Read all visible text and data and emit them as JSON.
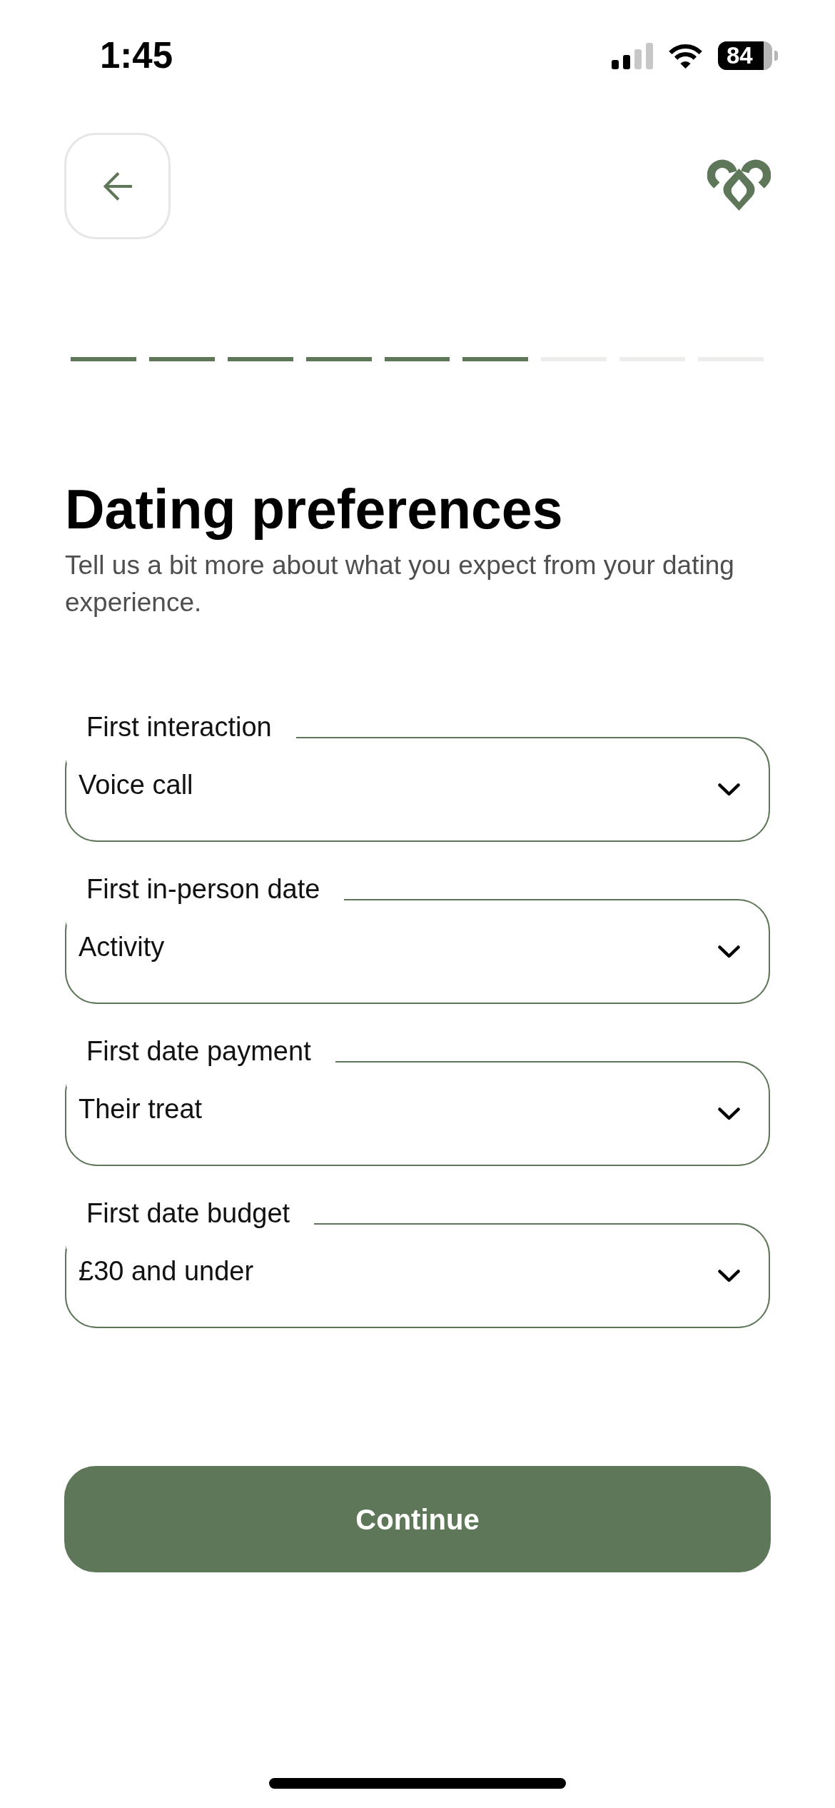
{
  "status_bar": {
    "time": "1:45",
    "battery": "84"
  },
  "progress": {
    "steps": [
      {
        "completed": true
      },
      {
        "completed": true
      },
      {
        "completed": true
      },
      {
        "completed": true
      },
      {
        "completed": true
      },
      {
        "completed": true
      },
      {
        "completed": false
      },
      {
        "completed": false
      },
      {
        "completed": false
      }
    ]
  },
  "title": "Dating preferences",
  "subtitle": "Tell us a bit more about what you expect from your dating experience.",
  "fields": [
    {
      "label": "First interaction",
      "value": "Voice call"
    },
    {
      "label": "First in-person date",
      "value": "Activity"
    },
    {
      "label": "First date payment",
      "value": "Their treat"
    },
    {
      "label": "First date budget",
      "value": "£30 and under"
    }
  ],
  "continue_button": {
    "label": "Continue"
  }
}
